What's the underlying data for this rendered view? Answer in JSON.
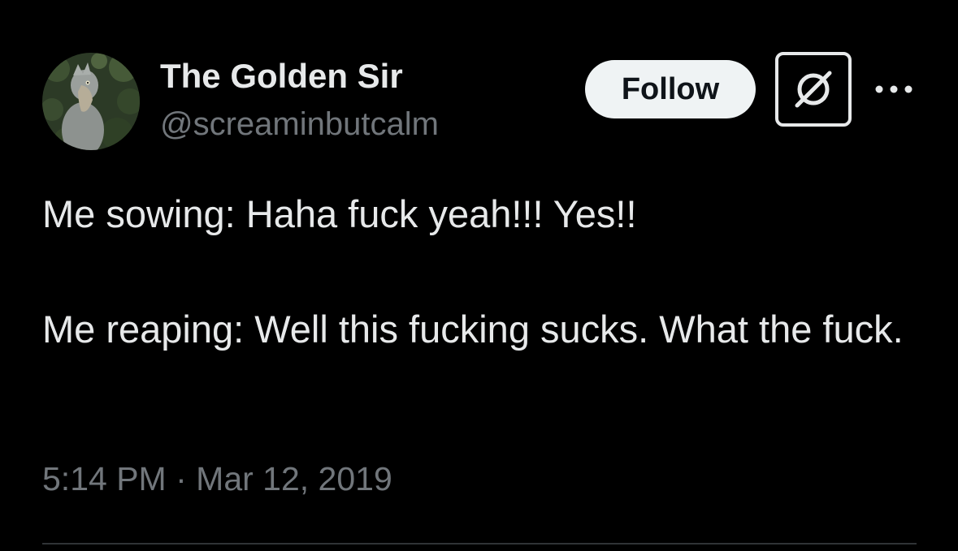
{
  "author": {
    "display_name": "The Golden Sir",
    "handle": "@screaminbutcalm",
    "avatar_subject": "shoebill-bird"
  },
  "actions": {
    "follow_label": "Follow",
    "grok_icon": "grok-icon",
    "more_icon": "more-horizontal-icon"
  },
  "tweet": {
    "text": "Me sowing: Haha fuck yeah!!! Yes!!\n\nMe reaping: Well this fucking sucks. What the fuck.",
    "time": "5:14 PM",
    "separator": "·",
    "date": "Mar 12, 2019"
  },
  "colors": {
    "background": "#000000",
    "primary_text": "#e7e9ea",
    "secondary_text": "#71767b",
    "follow_button_bg": "#eff3f4",
    "follow_button_text": "#0f1419",
    "divider": "#2f3336"
  }
}
